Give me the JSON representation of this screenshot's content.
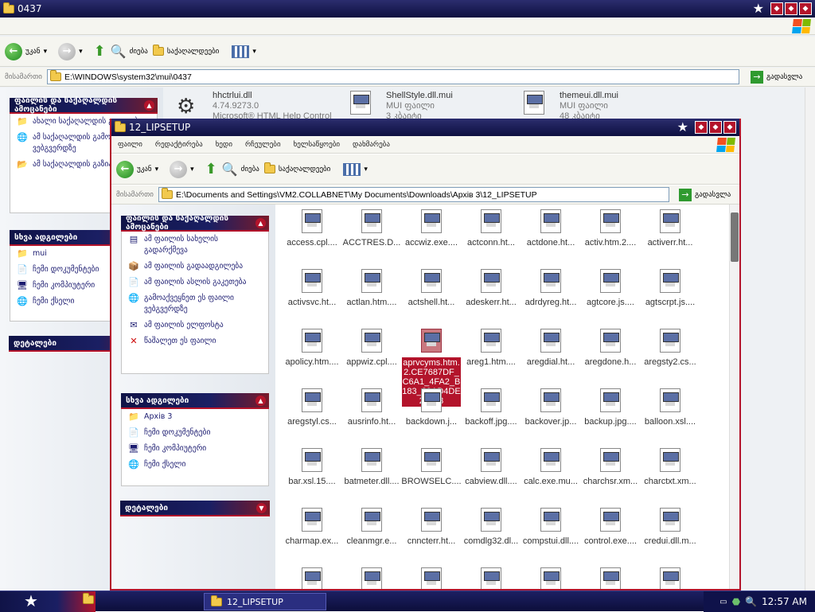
{
  "back_window": {
    "title": "0437",
    "toolbar": {
      "back": "უკან",
      "search": "ძიება",
      "folders": "საქაღალდეები"
    },
    "address": {
      "label": "მისამართი",
      "path": "E:\\WINDOWS\\system32\\mui\\0437",
      "go": "გადასვლა"
    },
    "files": [
      {
        "name": "hhctrlui.dll",
        "line2": "4.74.9273.0",
        "line3": "Microsoft® HTML Help Control"
      },
      {
        "name": "ShellStyle.dll.mui",
        "line2": "MUI ფაილი",
        "line3": "3 კბაიტი"
      },
      {
        "name": "themeui.dll.mui",
        "line2": "MUI ფაილი",
        "line3": "48 კბაიტი"
      }
    ],
    "tasks_header": "ფაილის და საქაღალდის ამოცანები",
    "tasks": [
      "ახალი საქაღალდის გაკეთება",
      "ამ საქაღალდის გამოქვეყნება ვებგვერდზე",
      "ამ საქაღალდის გაზიარება"
    ],
    "places_header": "სხვა ადგილები",
    "places": [
      "mui",
      "ჩემი დოკუმენტები",
      "ჩემი კომპიუტერი",
      "ჩემი ქსელი"
    ],
    "details_header": "დეტალები"
  },
  "front_window": {
    "title": "12_LIPSETUP",
    "menu": [
      "ფაილი",
      "რედაქტირება",
      "ხედი",
      "რჩეულები",
      "ხელსაწყოები",
      "დახმარება"
    ],
    "toolbar": {
      "back": "უკან",
      "search": "ძიება",
      "folders": "საქაღალდეები"
    },
    "address": {
      "label": "მისამართი",
      "path": "E:\\Documents and Settings\\VM2.COLLABNET\\My Documents\\Downloads\\Архів 3\\12_LIPSETUP",
      "go": "გადასვლა"
    },
    "tasks_header": "ფაილის და საქაღალდის ამოცანები",
    "tasks": [
      "ამ ფაილის სახელის გადარქმევა",
      "ამ ფაილის გადაადგილება",
      "ამ ფაილის ასლის გაკეთება",
      "გამოაქვეყნეთ ეს ფაილი ვებგვერდზე",
      "ამ ფაილის ელფოსტა",
      "წაშალეთ ეს ფაილი"
    ],
    "places_header": "სხვა ადგილები",
    "places": [
      "Архів 3",
      "ჩემი დოკუმენტები",
      "ჩემი კომპიუტერი",
      "ჩემი ქსელი"
    ],
    "details_header": "დეტალები",
    "files": [
      "access.cpl....",
      "ACCTRES.D...",
      "accwiz.exe....",
      "actconn.ht...",
      "actdone.ht...",
      "activ.htm.2....",
      "activerr.ht...",
      "activsvc.ht...",
      "actlan.htm....",
      "actshell.ht...",
      "adeskerr.ht...",
      "adrdyreg.ht...",
      "agtcore.js....",
      "agtscrpt.js....",
      "apolicy.htm....",
      "appwiz.cpl....",
      "aprvcyms.htm.2.CE7687DF_C6A1_4FA2_B183_39AD4DE21043",
      "areg1.htm....",
      "aregdial.ht...",
      "aregdone.h...",
      "aregsty2.cs...",
      "aregstyl.cs...",
      "ausrinfo.ht...",
      "backdown.j...",
      "backoff.jpg....",
      "backover.jp...",
      "backup.jpg....",
      "balloon.xsl....",
      "bar.xsl.15....",
      "batmeter.dll....",
      "BROWSELC....",
      "cabview.dll....",
      "calc.exe.mu...",
      "charchsr.xm...",
      "charctxt.xm...",
      "charmap.ex...",
      "cleanmgr.e...",
      "cnncterr.ht...",
      "comdlg32.dl...",
      "compstui.dll....",
      "control.exe....",
      "credui.dll.m...",
      "",
      "",
      "",
      "",
      "",
      "",
      ""
    ],
    "selected_index": 16
  },
  "taskbar": {
    "item": "12_LIPSETUP",
    "clock": "12:57 AM"
  },
  "colors": {
    "accent": "#b3142b",
    "navy": "#101347",
    "selection": "#b3142b"
  }
}
